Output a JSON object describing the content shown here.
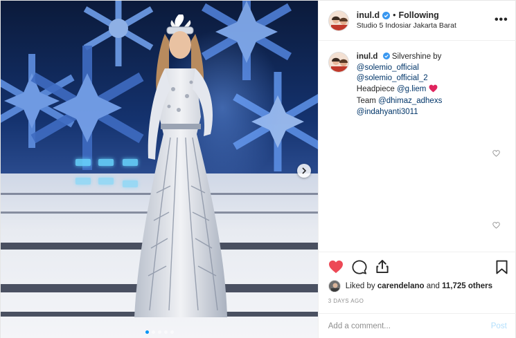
{
  "post": {
    "username": "inul.d",
    "follow_separator": "•",
    "follow_status": "Following",
    "location": "Studio 5 Indosiar Jakarta Barat",
    "more_icon": "more-dots-icon",
    "verified_icon": "verified-badge-icon",
    "verified_color": "#3897f0"
  },
  "caption": {
    "username": "inul.d",
    "line1": "Silvershine by",
    "mention1": "@solemio_official",
    "mention2": "@solemio_official_2",
    "headpiece_label": "Headpiece",
    "mention3": "@g.liem",
    "team_label": "Team",
    "mention4": "@dhimaz_adhexs",
    "mention5": "@indahyanti3011",
    "heart_emoji_color": "#e0245e"
  },
  "actions": {
    "like_icon": "heart-filled-icon",
    "like_color": "#ed4956",
    "comment_icon": "comment-icon",
    "share_icon": "share-icon",
    "save_icon": "bookmark-icon"
  },
  "likes": {
    "prefix": "Liked by",
    "user": "carendelano",
    "conjunction": "and",
    "count": "11,725 others"
  },
  "date": "3 DAYS AGO",
  "comment_box": {
    "placeholder": "Add a comment...",
    "post_label": "Post"
  },
  "carousel": {
    "total": 5,
    "active_index": 0,
    "next_icon": "chevron-right-icon"
  }
}
